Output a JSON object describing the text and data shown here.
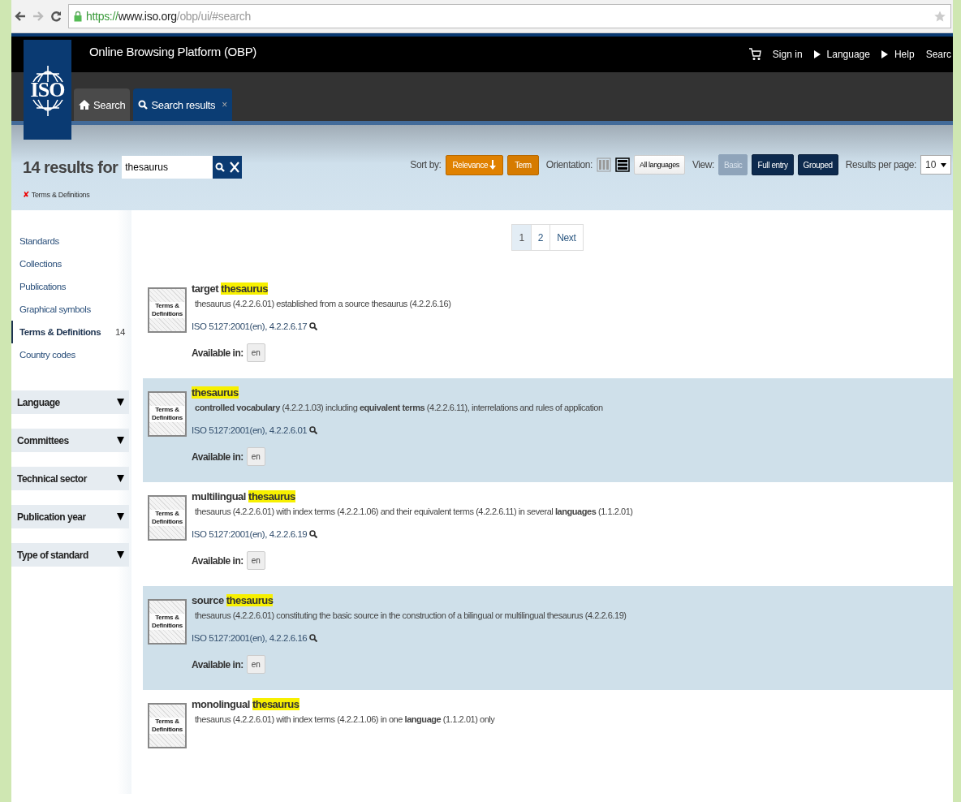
{
  "browser": {
    "url": {
      "scheme": "https://",
      "host": "www.iso.org",
      "path": "/obp/ui/#search"
    }
  },
  "header": {
    "logo": "ISO",
    "title": "Online Browsing Platform (OBP)",
    "links": [
      {
        "kind": "cart"
      },
      {
        "kind": "plain",
        "label": "Sign in"
      },
      {
        "kind": "arrow",
        "label": "Language"
      },
      {
        "kind": "arrow",
        "label": "Help"
      },
      {
        "kind": "plain",
        "label": "Searc"
      }
    ]
  },
  "tabs": [
    {
      "label": "Search",
      "kind": "home",
      "selected": false
    },
    {
      "label": "Search results",
      "kind": "search",
      "selected": true,
      "close": "×"
    }
  ],
  "search": {
    "count_label": "14 results for",
    "value": "thesaurus",
    "filters": [
      {
        "remove": "✘",
        "label": "Terms & Definitions"
      }
    ]
  },
  "toolbar": {
    "sort_label": "Sort by:",
    "sort": [
      {
        "label": "Relevance",
        "selected": true
      },
      {
        "label": "Term",
        "selected": false
      }
    ],
    "orientation_label": "Orientation:",
    "orientations": [
      {
        "kind": "columns",
        "selected": true
      },
      {
        "kind": "rows",
        "selected": false
      }
    ],
    "languages_button": "All languages",
    "view_label": "View:",
    "views": [
      {
        "label": "Basic",
        "selected": true
      },
      {
        "label": "Full entry",
        "selected": false
      },
      {
        "label": "Grouped",
        "selected": false
      }
    ],
    "per_page_label": "Results per page:",
    "per_page": "10"
  },
  "sidebar": {
    "nav": [
      {
        "label": "Standards",
        "selected": false
      },
      {
        "label": "Collections",
        "selected": false
      },
      {
        "label": "Publications",
        "selected": false
      },
      {
        "label": "Graphical symbols",
        "selected": false
      },
      {
        "label": "Terms & Definitions",
        "count": "14",
        "selected": true
      },
      {
        "label": "Country codes",
        "selected": false
      }
    ],
    "facets": [
      {
        "label": "Language",
        "expanded": false
      },
      {
        "label": "Committees",
        "expanded": false
      },
      {
        "label": "Technical sector",
        "expanded": false
      },
      {
        "label": "Publication year",
        "expanded": false
      },
      {
        "label": "Type of standard",
        "expanded": false
      }
    ]
  },
  "pagination": [
    {
      "label": "1",
      "selected": true
    },
    {
      "label": "2",
      "selected": false
    },
    {
      "label": "Next",
      "selected": false
    }
  ],
  "results": [
    {
      "badge": "Terms & Definitions",
      "title": {
        "prefix": "target",
        "match": "thesaurus"
      },
      "definition": "thesaurus (4.2.2.6.01) established from a source thesaurus (4.2.2.6.16)",
      "reference": "ISO 5127:2001(en), 4.2.2.6.17",
      "available_label": "Available in:",
      "languages": [
        "en"
      ]
    },
    {
      "badge": "Terms & Definitions",
      "title": {
        "match": "thesaurus"
      },
      "definition": "**controlled vocabulary** (4.2.2.1.03) including **equivalent terms** (4.2.2.6.11), interrelations and rules of application",
      "reference": "ISO 5127:2001(en), 4.2.2.6.01",
      "available_label": "Available in:",
      "languages": [
        "en"
      ]
    },
    {
      "badge": "Terms & Definitions",
      "title": {
        "prefix": "multilingual",
        "match": "thesaurus"
      },
      "definition": "thesaurus (4.2.2.6.01) with index terms (4.2.2.1.06) and their equivalent terms (4.2.2.6.11) in several **languages** (1.1.2.01)",
      "reference": "ISO 5127:2001(en), 4.2.2.6.19",
      "available_label": "Available in:",
      "languages": [
        "en"
      ]
    },
    {
      "badge": "Terms & Definitions",
      "title": {
        "prefix": "source",
        "match": "thesaurus"
      },
      "definition": "thesaurus (4.2.2.6.01) constituting the basic source in the construction of a bilingual or multilingual thesaurus (4.2.2.6.19)",
      "reference": "ISO 5127:2001(en), 4.2.2.6.16",
      "available_label": "Available in:",
      "languages": [
        "en"
      ]
    },
    {
      "badge": "Terms & Definitions",
      "title": {
        "prefix": "monolingual",
        "match": "thesaurus"
      },
      "definition": "thesaurus (4.2.2.6.01) with index terms (4.2.2.1.06) in one **language** (1.1.2.01) only"
    }
  ]
}
